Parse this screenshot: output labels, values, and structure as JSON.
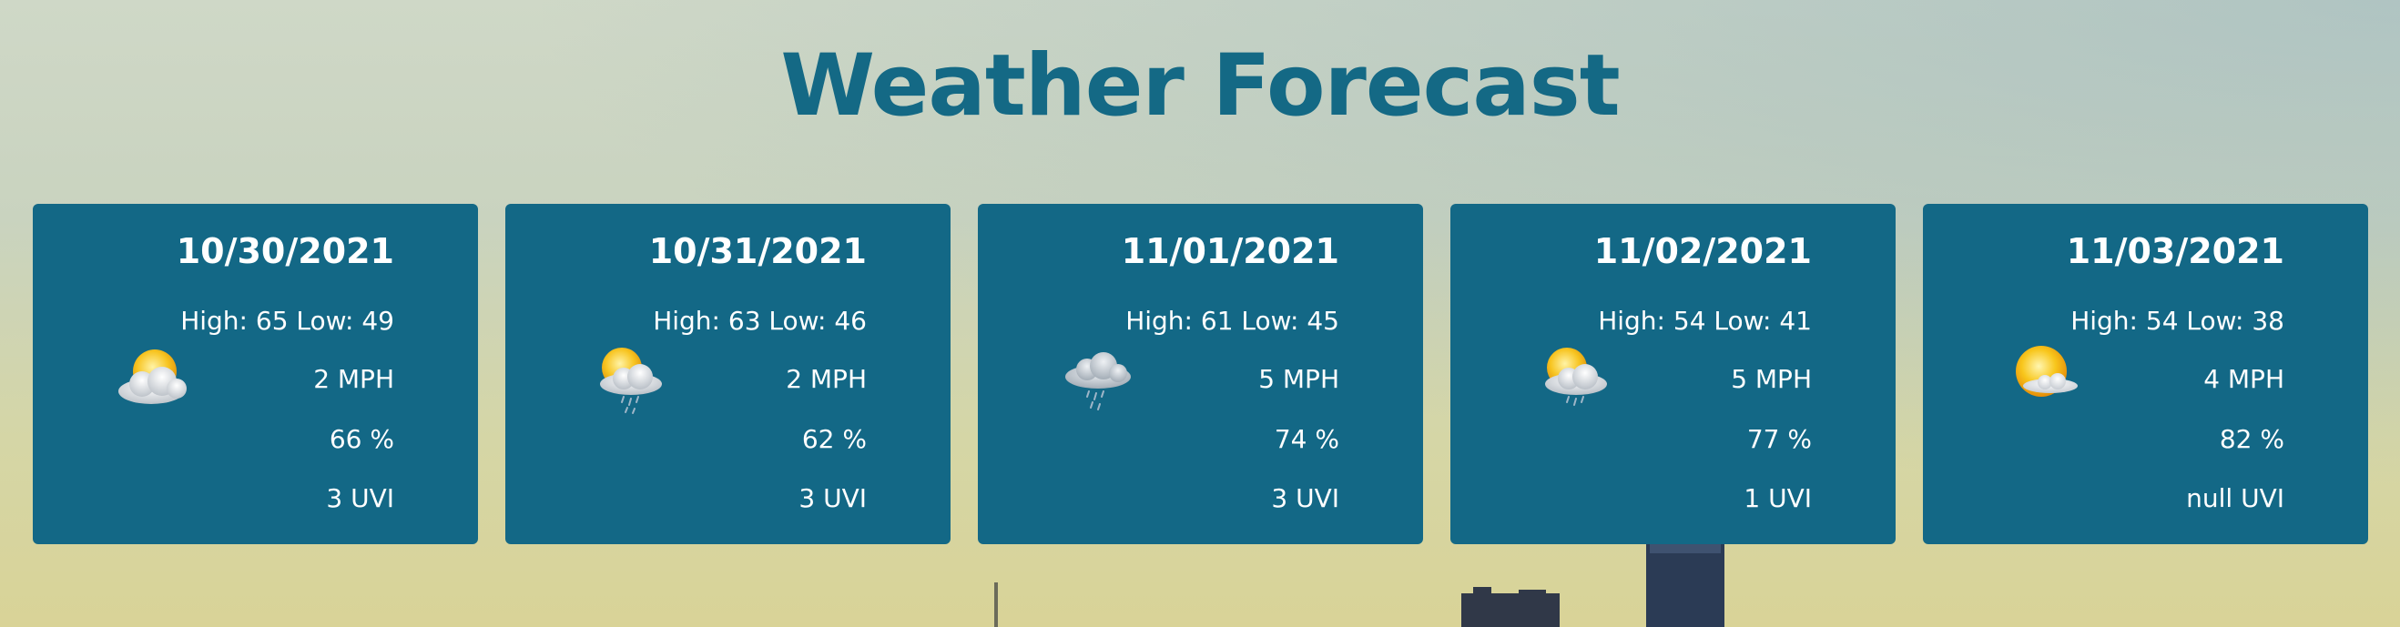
{
  "page": {
    "title": "Weather Forecast"
  },
  "forecast": [
    {
      "date": "10/30/2021",
      "high_low": "High: 65 Low: 49",
      "wind": "2 MPH",
      "humidity": "66 %",
      "uvi": "3 UVI",
      "icon": "sun-behind-cloud-icon"
    },
    {
      "date": "10/31/2021",
      "high_low": "High: 63 Low: 46",
      "wind": "2 MPH",
      "humidity": "62 %",
      "uvi": "3 UVI",
      "icon": "sun-cloud-rain-icon"
    },
    {
      "date": "11/01/2021",
      "high_low": "High: 61 Low: 45",
      "wind": "5 MPH",
      "humidity": "74 %",
      "uvi": "3 UVI",
      "icon": "rain-cloud-icon"
    },
    {
      "date": "11/02/2021",
      "high_low": "High: 54 Low: 41",
      "wind": "5 MPH",
      "humidity": "77 %",
      "uvi": "1 UVI",
      "icon": "sun-cloud-rain-icon"
    },
    {
      "date": "11/03/2021",
      "high_low": "High: 54 Low: 38",
      "wind": "4 MPH",
      "humidity": "82 %",
      "uvi": "null UVI",
      "icon": "sun-behind-small-cloud-icon"
    }
  ],
  "colors": {
    "title": "#146985",
    "card_background": "#136886",
    "card_text": "#ffffff"
  }
}
